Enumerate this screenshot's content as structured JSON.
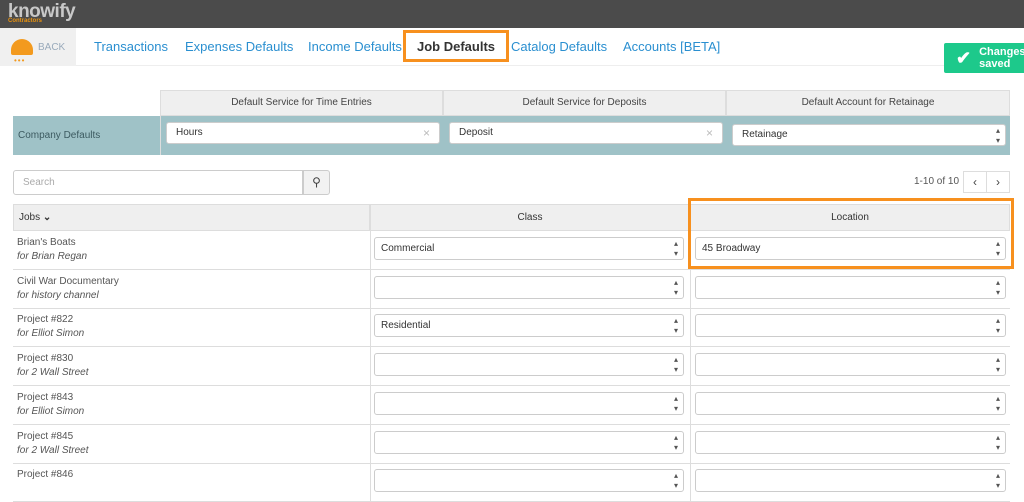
{
  "app": {
    "logo": "knowify",
    "logo_sub": "Contractors",
    "back_label": "BACK"
  },
  "tabs": [
    {
      "label": "Transactions"
    },
    {
      "label": "Expenses Defaults"
    },
    {
      "label": "Income Defaults"
    },
    {
      "label": "Job Defaults",
      "active": true
    },
    {
      "label": "Catalog Defaults"
    },
    {
      "label": "Accounts [BETA]"
    }
  ],
  "status": {
    "saved_label": "Changes saved"
  },
  "defaults": {
    "row_label": "Company Defaults",
    "headers": [
      "Default Service for Time Entries",
      "Default Service for Deposits",
      "Default Account for Retainage"
    ],
    "values": [
      "Hours",
      "Deposit",
      "Retainage"
    ]
  },
  "search": {
    "placeholder": "Search"
  },
  "pagination": {
    "text": "1-10 of 10",
    "prev": "‹",
    "next": "›"
  },
  "table": {
    "headers": {
      "jobs": "Jobs",
      "sort": "⌄",
      "class": "Class",
      "location": "Location"
    },
    "rows": [
      {
        "name": "Brian's Boats",
        "client": "for Brian Regan",
        "class": "Commercial",
        "location": "45 Broadway"
      },
      {
        "name": "Civil War Documentary",
        "client": "for history channel",
        "class": "",
        "location": ""
      },
      {
        "name": "Project #822",
        "client": "for Elliot Simon",
        "class": "Residential",
        "location": ""
      },
      {
        "name": "Project #830",
        "client": "for 2 Wall Street",
        "class": "",
        "location": ""
      },
      {
        "name": "Project #843",
        "client": "for Elliot Simon",
        "class": "",
        "location": ""
      },
      {
        "name": "Project #845",
        "client": "for 2 Wall Street",
        "class": "",
        "location": ""
      },
      {
        "name": "Project #846",
        "client": "",
        "class": "",
        "location": ""
      }
    ]
  }
}
